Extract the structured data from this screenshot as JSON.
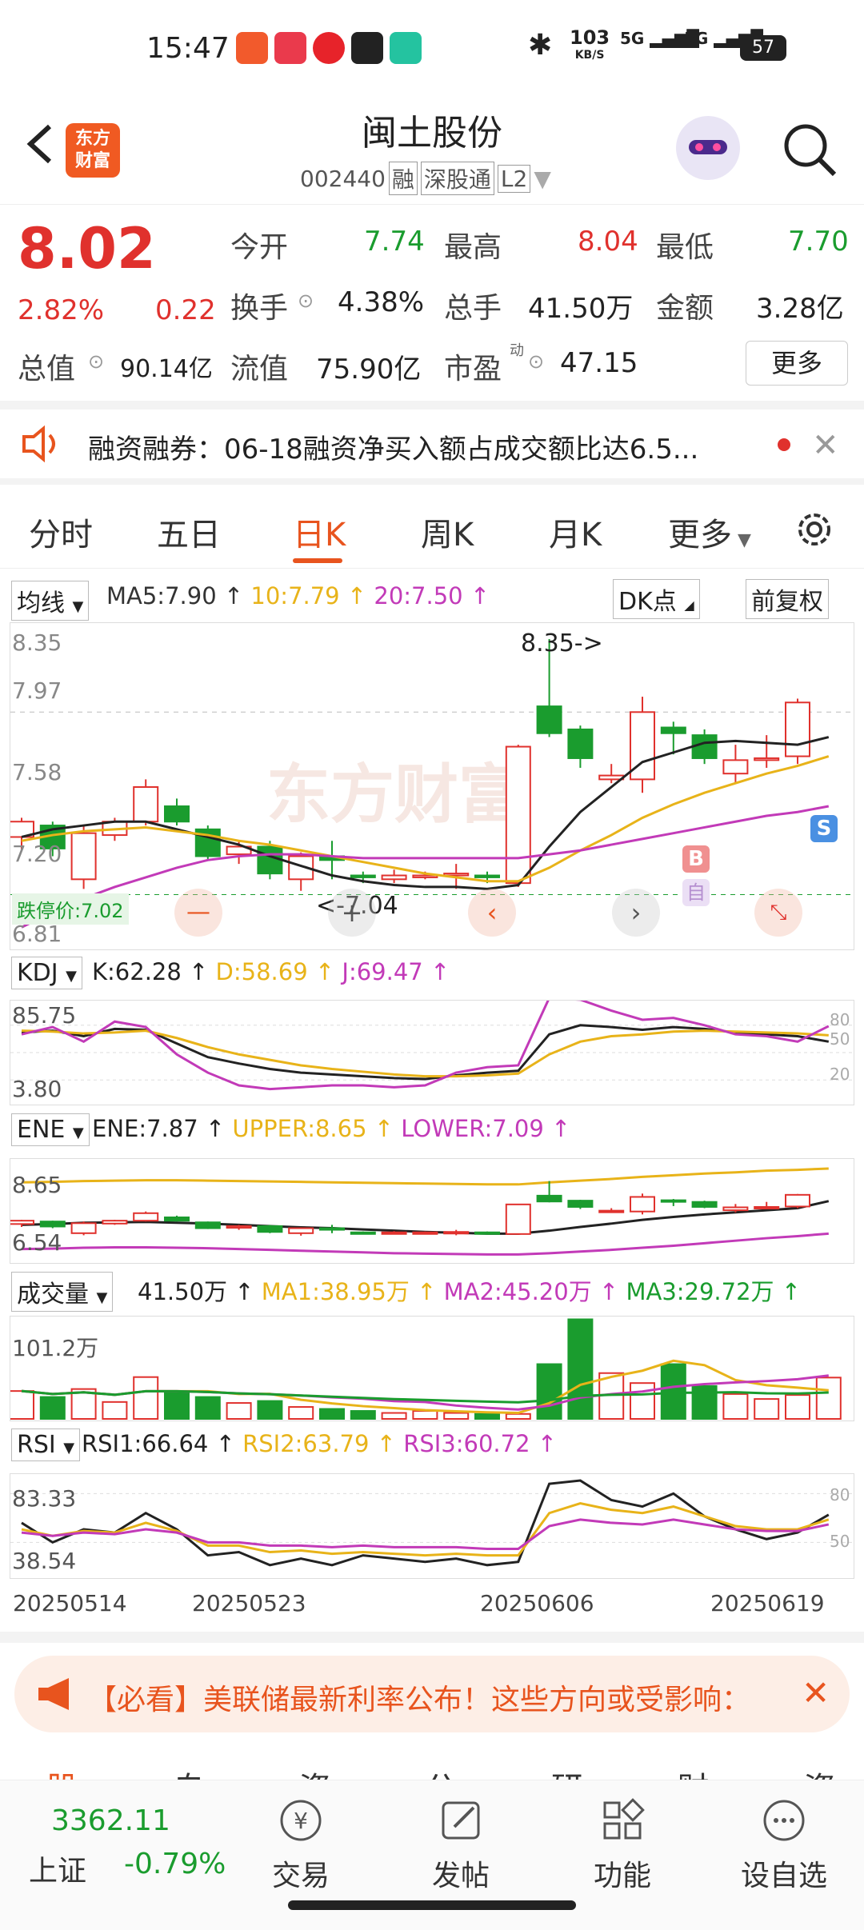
{
  "status_bar": {
    "time": "15:47",
    "net_speed_top": "103",
    "net_speed_unit": "KB/S",
    "sig1": "5G",
    "sig2": "5G",
    "battery": "57"
  },
  "header": {
    "logo_line1": "东方",
    "logo_line2": "财富",
    "stock_name": "闽土股份",
    "code": "002440",
    "tag1": "融",
    "tag2": "深股通",
    "tag3": "L2"
  },
  "quote": {
    "price": "8.02",
    "change_pct": "2.82%",
    "change": "0.22",
    "open_label": "今开",
    "open": "7.74",
    "high_label": "最高",
    "high": "8.04",
    "low_label": "最低",
    "low": "7.70",
    "turnover_label": "换手",
    "turnover": "4.38%",
    "volume_label": "总手",
    "volume": "41.50万",
    "amount_label": "金额",
    "amount": "3.28亿",
    "mktcap_label": "总值",
    "mktcap": "90.14亿",
    "float_label": "流值",
    "float_cap": "75.90亿",
    "pe_label": "市盈",
    "pe_sup": "动",
    "pe": "47.15",
    "more_label": "更多"
  },
  "notice": {
    "text": "融资融券：06-18融资净买入额占成交额比达6.5..."
  },
  "tabs": {
    "items": [
      "分时",
      "五日",
      "日K",
      "周K",
      "月K",
      "更多"
    ],
    "active": "日K"
  },
  "kline": {
    "ma_select": "均线",
    "ma5": "MA5:7.90 ↑",
    "ma10": "10:7.79 ↑",
    "ma20": "20:7.50 ↑",
    "dk_label": "DK点",
    "adjust_label": "前复权",
    "y_top": "8.35",
    "y_2": "7.97",
    "y_3": "7.58",
    "y_4": "7.20",
    "y_bottom": "6.81",
    "max_note": "8.35->",
    "min_note": "<-7.04",
    "limit_down": "跌停价:7.02",
    "b_marker": "B",
    "s_marker": "S",
    "zi_marker": "自"
  },
  "kdj": {
    "select": "KDJ",
    "k": "K:62.28 ↑",
    "d": "D:58.69 ↑",
    "j": "J:69.47 ↑",
    "y_top": "85.75",
    "y_bottom": "3.80",
    "r80": "80",
    "r50": "50",
    "r20": "20"
  },
  "ene": {
    "select": "ENE",
    "ene": "ENE:7.87 ↑",
    "upper": "UPPER:8.65 ↑",
    "lower": "LOWER:7.09 ↑",
    "y_top": "8.65",
    "y_bottom": "6.54"
  },
  "vol": {
    "select": "成交量",
    "vol": "41.50万 ↑",
    "ma1": "MA1:38.95万 ↑",
    "ma2": "MA2:45.20万 ↑",
    "ma3": "MA3:29.72万 ↑",
    "y_top": "101.2万"
  },
  "rsi": {
    "select": "RSI",
    "rsi1": "RSI1:66.64 ↑",
    "rsi2": "RSI2:63.79 ↑",
    "rsi3": "RSI3:60.72 ↑",
    "y_top": "83.33",
    "y_bottom": "38.54",
    "r80": "80",
    "r50": "50"
  },
  "dates": [
    "20250514",
    "20250523",
    "20250606",
    "20250619"
  ],
  "banner": {
    "text": "【必看】美联储最新利率公布！这些方向或受影响："
  },
  "bottom_tabs_partial": [
    "股吧",
    "自见",
    "资讯",
    "公告",
    "研报",
    "财务",
    "资料"
  ],
  "bottom_nav": {
    "index_value": "3362.11",
    "index_name": "上证",
    "index_change": "-0.79%",
    "items": [
      "交易",
      "发帖",
      "功能",
      "设自选"
    ]
  },
  "colors": {
    "up": "#e0312d",
    "down": "#1a9c2e",
    "accent": "#e8541e",
    "ma10": "#e8b319",
    "ma20": "#c23ab8"
  },
  "chart_data": [
    {
      "type": "candlestick",
      "title": "日K",
      "x": [
        "20250514",
        "",
        "",
        "",
        "",
        "",
        "",
        "20250523",
        "",
        "",
        "",
        "",
        "",
        "",
        "",
        "",
        "",
        "20250606",
        "",
        "",
        "",
        "",
        "",
        "",
        "",
        "",
        "",
        "20250619"
      ],
      "series": [
        {
          "name": "MA5",
          "values": [
            7.32,
            7.36,
            7.38,
            7.4,
            7.4,
            7.36,
            7.32,
            7.28,
            7.22,
            7.17,
            7.12,
            7.09,
            7.07,
            7.06,
            7.06,
            7.05,
            7.07,
            7.27,
            7.45,
            7.58,
            7.71,
            7.76,
            7.81,
            7.82,
            7.81,
            7.8,
            7.84,
            7.9
          ]
        },
        {
          "name": "MA10",
          "values": [
            7.3,
            7.33,
            7.35,
            7.36,
            7.37,
            7.35,
            7.33,
            7.3,
            7.28,
            7.25,
            7.22,
            7.19,
            7.16,
            7.13,
            7.11,
            7.09,
            7.09,
            7.16,
            7.25,
            7.33,
            7.42,
            7.49,
            7.55,
            7.6,
            7.65,
            7.69,
            7.74,
            7.79
          ]
        },
        {
          "name": "MA20",
          "values": [
            6.85,
            6.93,
            7.0,
            7.06,
            7.11,
            7.16,
            7.2,
            7.22,
            7.23,
            7.23,
            7.22,
            7.21,
            7.21,
            7.21,
            7.21,
            7.21,
            7.21,
            7.23,
            7.25,
            7.28,
            7.31,
            7.34,
            7.37,
            7.4,
            7.43,
            7.45,
            7.48,
            7.5
          ]
        }
      ]
    },
    {
      "type": "bar",
      "title": "成交量",
      "ylim": [
        0,
        101.2
      ],
      "values": [
        28,
        22,
        30,
        17,
        42,
        28,
        22,
        16,
        18,
        12,
        10,
        8,
        6,
        8,
        6,
        5,
        5,
        55,
        100,
        46,
        36,
        55,
        33,
        25,
        20,
        24,
        41.5
      ]
    }
  ]
}
